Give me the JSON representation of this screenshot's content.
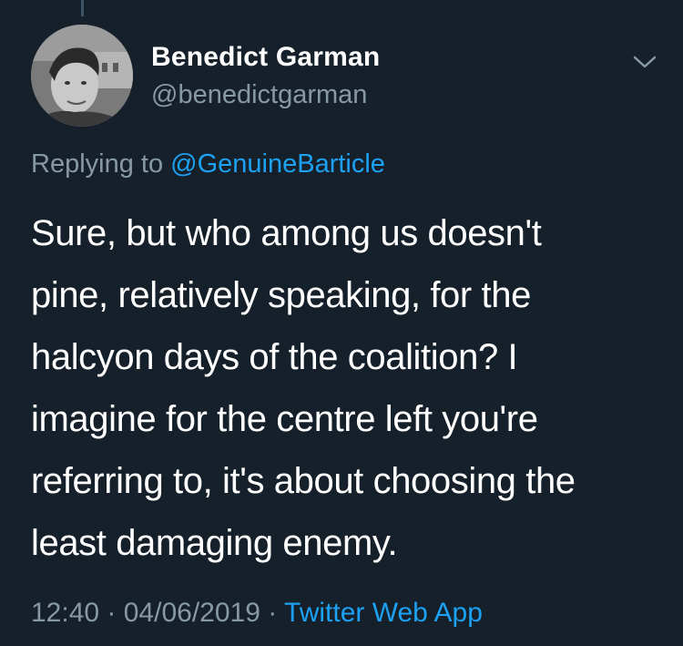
{
  "author": {
    "name": "Benedict Garman",
    "handle": "@benedictgarman"
  },
  "reply": {
    "prefix": "Replying to ",
    "mention": "@GenuineBarticle"
  },
  "tweet": {
    "lines": [
      "Sure, but who among us doesn't",
      "pine, relatively speaking, for the",
      "halcyon days of the coalition? I",
      "imagine for the centre left you're",
      "referring to, it's about choosing the",
      "least damaging enemy."
    ]
  },
  "meta": {
    "time": "12:40",
    "separator": " · ",
    "date": "04/06/2019",
    "source": "Twitter Web App"
  },
  "icons": {
    "menu": "chevron-down-icon"
  },
  "colors": {
    "background": "#15202b",
    "secondary_text": "#8899a6",
    "link": "#1da1f2",
    "primary_text": "#ffffff"
  }
}
